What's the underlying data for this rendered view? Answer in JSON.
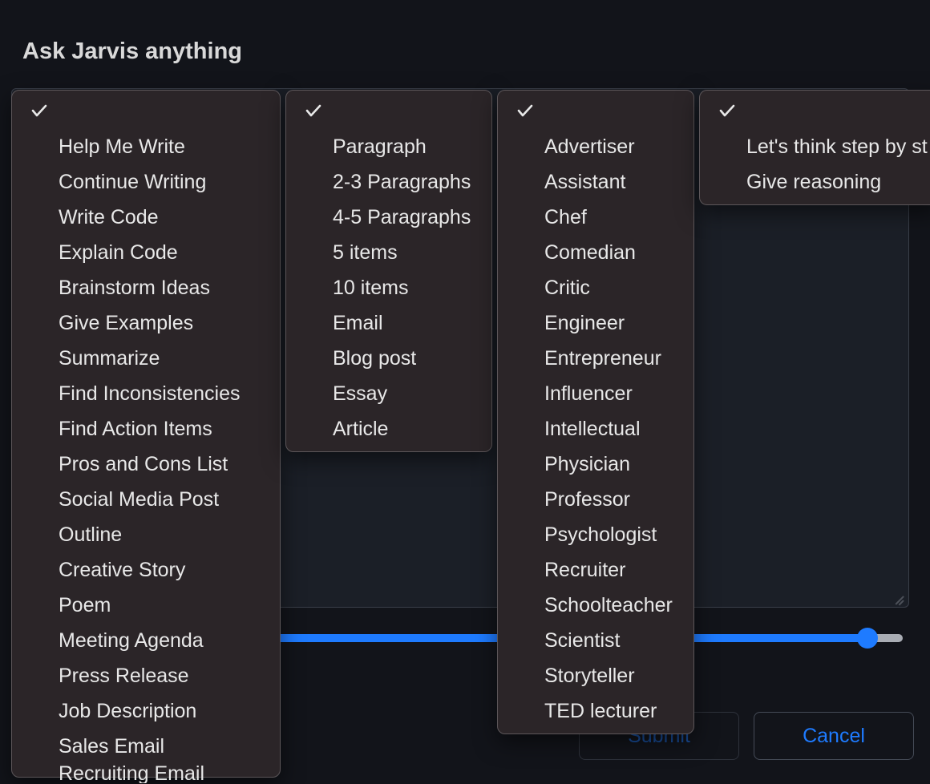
{
  "title": "Ask Jarvis anything",
  "slider": {
    "value": 96,
    "min": 0,
    "max": 100
  },
  "buttons": {
    "submit": "Submit",
    "cancel": "Cancel"
  },
  "dropdowns": {
    "tasks": {
      "checked": true,
      "items": [
        "Help Me Write",
        "Continue Writing",
        "Write Code",
        "Explain Code",
        "Brainstorm Ideas",
        "Give Examples",
        "Summarize",
        "Find Inconsistencies",
        "Find Action Items",
        "Pros and Cons List",
        "Social Media Post",
        "Outline",
        "Creative Story",
        "Poem",
        "Meeting Agenda",
        "Press Release",
        "Job Description",
        "Sales Email",
        "Recruiting Email"
      ]
    },
    "length": {
      "checked": true,
      "items": [
        "Paragraph",
        "2-3 Paragraphs",
        "4-5 Paragraphs",
        "5 items",
        "10 items",
        "Email",
        "Blog post",
        "Essay",
        "Article"
      ]
    },
    "role": {
      "checked": true,
      "items": [
        "Advertiser",
        "Assistant",
        "Chef",
        "Comedian",
        "Critic",
        "Engineer",
        "Entrepreneur",
        "Influencer",
        "Intellectual",
        "Physician",
        "Professor",
        "Psychologist",
        "Recruiter",
        "Schoolteacher",
        "Scientist",
        "Storyteller",
        "TED lecturer"
      ]
    },
    "reasoning": {
      "checked": true,
      "items": [
        "Let's think step by st",
        "Give reasoning"
      ]
    }
  }
}
